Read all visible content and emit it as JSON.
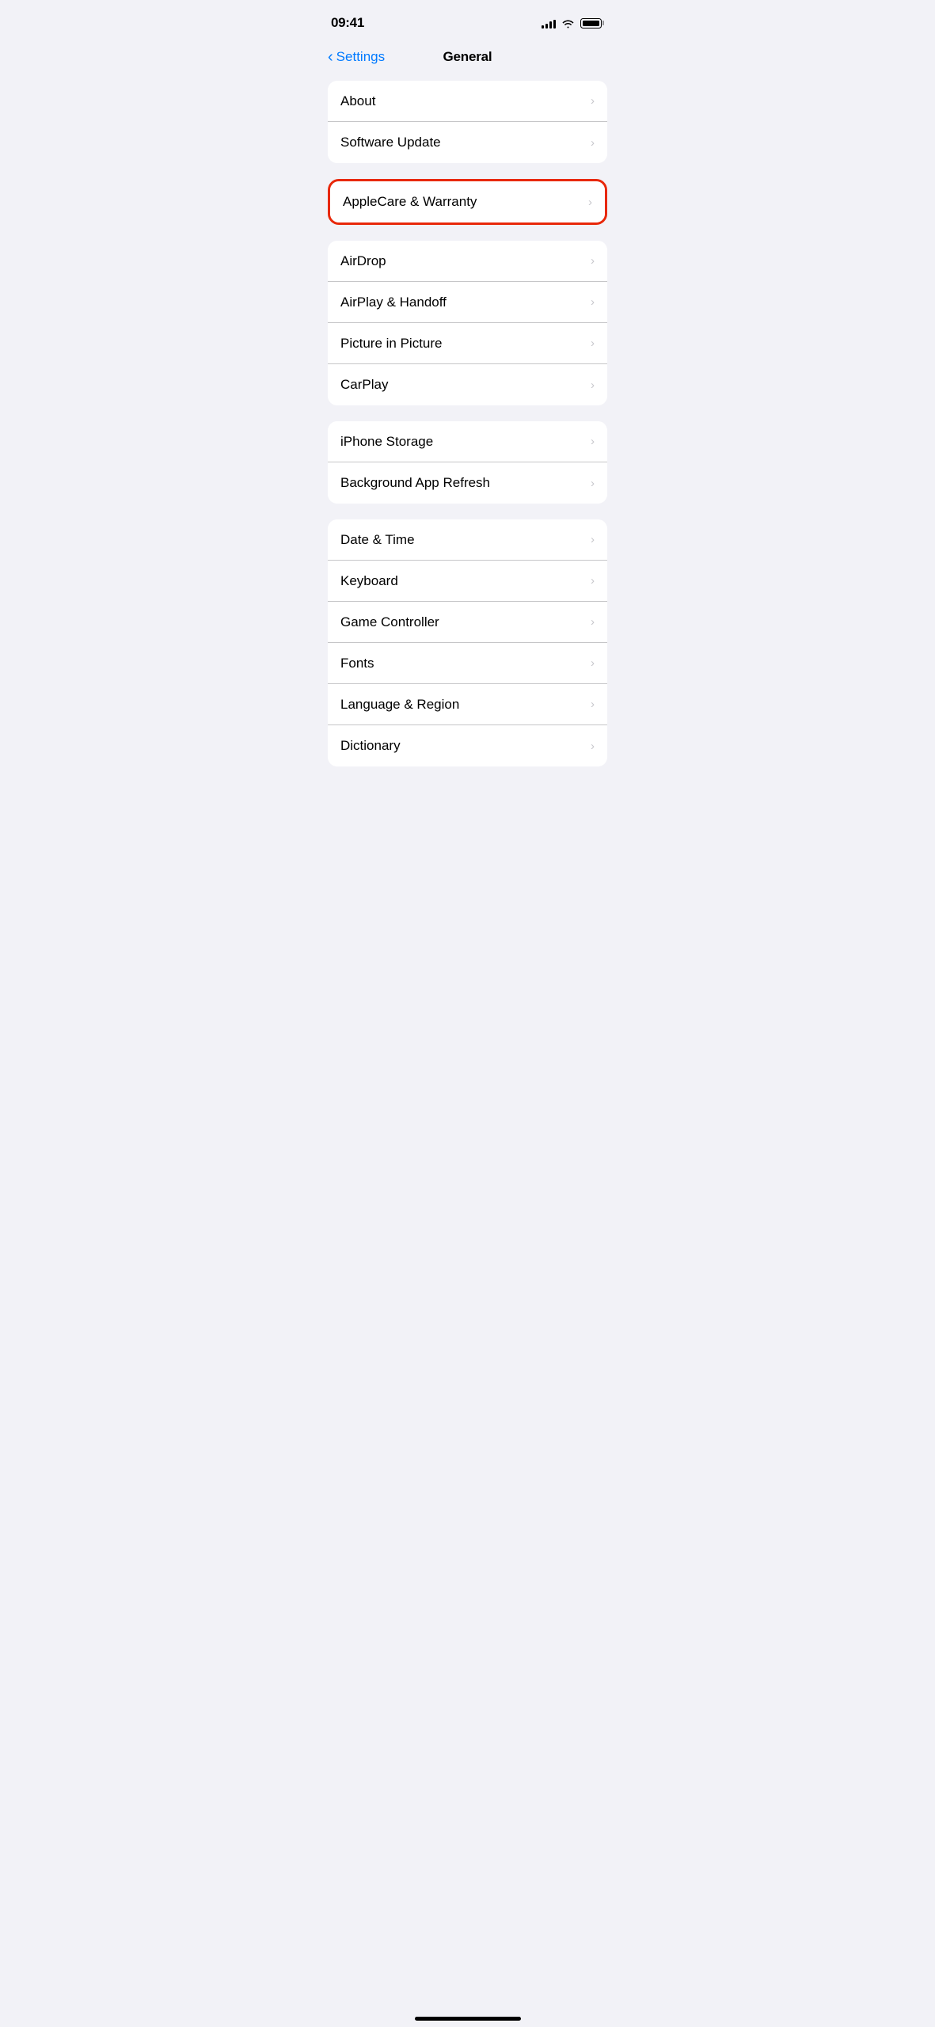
{
  "statusBar": {
    "time": "09:41",
    "signalBars": [
      4,
      6,
      9,
      11,
      13
    ],
    "batteryFull": true
  },
  "navBar": {
    "backLabel": "Settings",
    "title": "General"
  },
  "sections": [
    {
      "id": "section-1",
      "highlighted": false,
      "items": [
        {
          "label": "About",
          "id": "about"
        },
        {
          "label": "Software Update",
          "id": "software-update"
        }
      ]
    },
    {
      "id": "section-applecare",
      "highlighted": true,
      "items": [
        {
          "label": "AppleCare & Warranty",
          "id": "applecare-warranty"
        }
      ]
    },
    {
      "id": "section-3",
      "highlighted": false,
      "items": [
        {
          "label": "AirDrop",
          "id": "airdrop"
        },
        {
          "label": "AirPlay & Handoff",
          "id": "airplay-handoff"
        },
        {
          "label": "Picture in Picture",
          "id": "picture-in-picture"
        },
        {
          "label": "CarPlay",
          "id": "carplay"
        }
      ]
    },
    {
      "id": "section-4",
      "highlighted": false,
      "items": [
        {
          "label": "iPhone Storage",
          "id": "iphone-storage"
        },
        {
          "label": "Background App Refresh",
          "id": "background-app-refresh"
        }
      ]
    },
    {
      "id": "section-5",
      "highlighted": false,
      "items": [
        {
          "label": "Date & Time",
          "id": "date-time"
        },
        {
          "label": "Keyboard",
          "id": "keyboard"
        },
        {
          "label": "Game Controller",
          "id": "game-controller"
        },
        {
          "label": "Fonts",
          "id": "fonts"
        },
        {
          "label": "Language & Region",
          "id": "language-region"
        },
        {
          "label": "Dictionary",
          "id": "dictionary"
        }
      ]
    }
  ],
  "chevron": "›"
}
